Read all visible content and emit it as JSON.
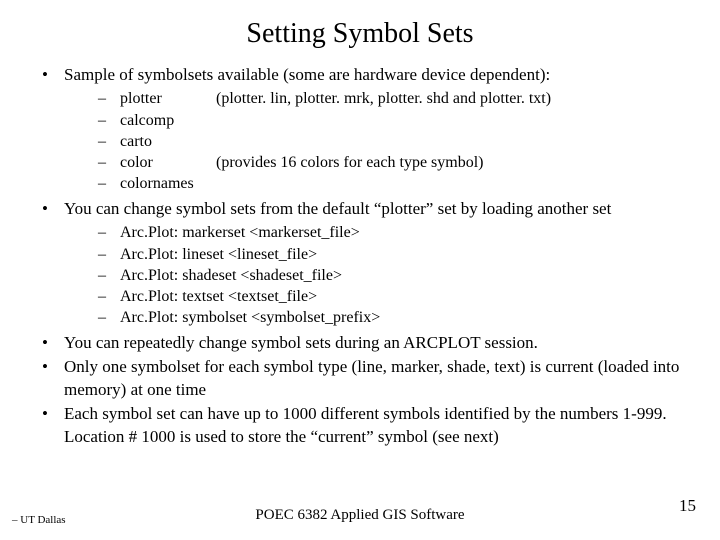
{
  "title": "Setting Symbol Sets",
  "bullets": {
    "b0": "Sample of symbolsets available (some are hardware device dependent):",
    "b1": "You can change symbol sets from the default “plotter” set by loading another set",
    "b2": "You can repeatedly change symbol sets during an ARCPLOT session.",
    "b3": "Only one symbolset for each symbol type (line, marker, shade, text) is current (loaded into memory) at one time",
    "b4": "Each symbol set can have up to 1000  different symbols identified by the numbers 1-999. Location # 1000 is used to store the “current” symbol (see next)"
  },
  "symsets": {
    "s0": {
      "name": "plotter",
      "note": "(plotter. lin, plotter. mrk, plotter. shd and plotter. txt)"
    },
    "s1": {
      "name": "calcomp",
      "note": ""
    },
    "s2": {
      "name": "carto",
      "note": ""
    },
    "s3": {
      "name": "color",
      "note": "(provides 16 colors for each type symbol)"
    },
    "s4": {
      "name": "colornames",
      "note": ""
    }
  },
  "cmds": {
    "c0": {
      "prefix": "Arc.Plot:",
      "rest": "markerset  <markerset_file>"
    },
    "c1": {
      "prefix": "Arc.Plot:",
      "rest": "lineset   <lineset_file>"
    },
    "c2": {
      "prefix": "Arc.Plot:",
      "rest": "shadeset  <shadeset_file>"
    },
    "c3": {
      "prefix": "Arc.Plot:",
      "rest": "textset  <textset_file>"
    },
    "c4": {
      "prefix": "Arc.Plot:",
      "rest": "symbolset <symbolset_prefix>"
    }
  },
  "footer": {
    "left": "– UT Dallas",
    "center": "POEC 6382 Applied GIS Software",
    "page": "15"
  }
}
